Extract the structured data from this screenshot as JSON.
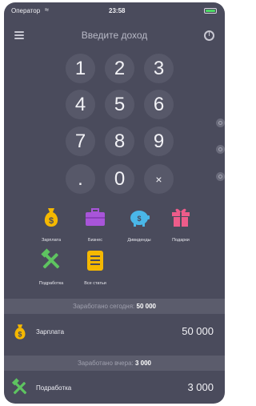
{
  "status_bar": {
    "carrier": "Оператор",
    "time": "23:58"
  },
  "header": {
    "title": "Введите доход"
  },
  "keypad": {
    "keys": [
      "1",
      "2",
      "3",
      "4",
      "5",
      "6",
      "7",
      "8",
      "9",
      ".",
      "0",
      "×"
    ]
  },
  "categories": [
    {
      "label": "Зарплата",
      "icon": "money-bag-icon"
    },
    {
      "label": "Бизнес",
      "icon": "briefcase-icon"
    },
    {
      "label": "Дивиденды",
      "icon": "piggy-bank-icon"
    },
    {
      "label": "Подарки",
      "icon": "gift-icon"
    },
    {
      "label": "Подработка",
      "icon": "hammer-icon"
    },
    {
      "label": "Все статьи",
      "icon": "list-icon"
    }
  ],
  "sections": [
    {
      "header_prefix": "Заработано сегодня:",
      "header_value": "50 000",
      "row": {
        "name": "Зарплата",
        "amount": "50 000"
      }
    },
    {
      "header_prefix": "Заработано вчера:",
      "header_value": "3 000",
      "row": {
        "name": "Подработка",
        "amount": "3 000"
      }
    }
  ],
  "colors": {
    "background": "#4a4b5c",
    "key": "#575869",
    "section_header": "#5b5c6c",
    "salary": "#f5b800",
    "business": "#a855d9",
    "dividends": "#4ab7e8",
    "gifts": "#ee5c8a",
    "side_job": "#5ec460",
    "all_items": "#f5b800"
  }
}
